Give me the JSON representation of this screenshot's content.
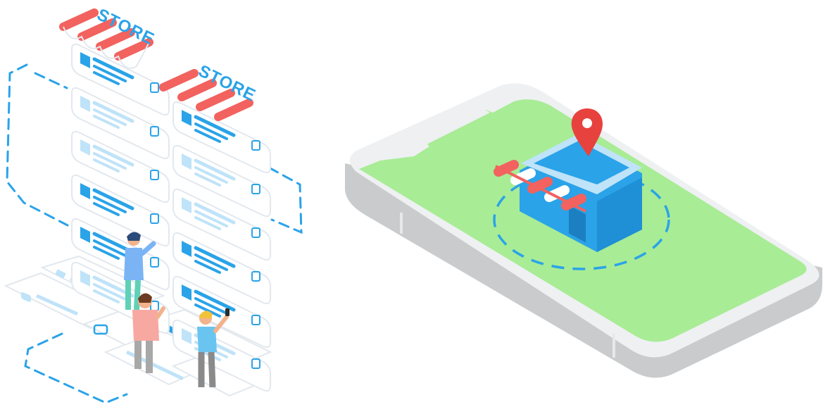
{
  "store_signs": [
    "STORE",
    "STORE"
  ],
  "colors": {
    "awning_red": "#f2625f",
    "awning_white": "#ffffff",
    "brand_blue": "#2aa3e8",
    "light_blue": "#bfe3f8",
    "card_border": "#e2e8ee",
    "map_green": "#a8ec96",
    "phone_body": "#e6e8ea",
    "phone_side": "#c9cbcd",
    "pin_red": "#e8423f",
    "skin": "#f2b38c"
  },
  "icons": [
    "store-awning-icon",
    "location-pin-icon",
    "smartphone-icon",
    "checkbox-icon"
  ]
}
